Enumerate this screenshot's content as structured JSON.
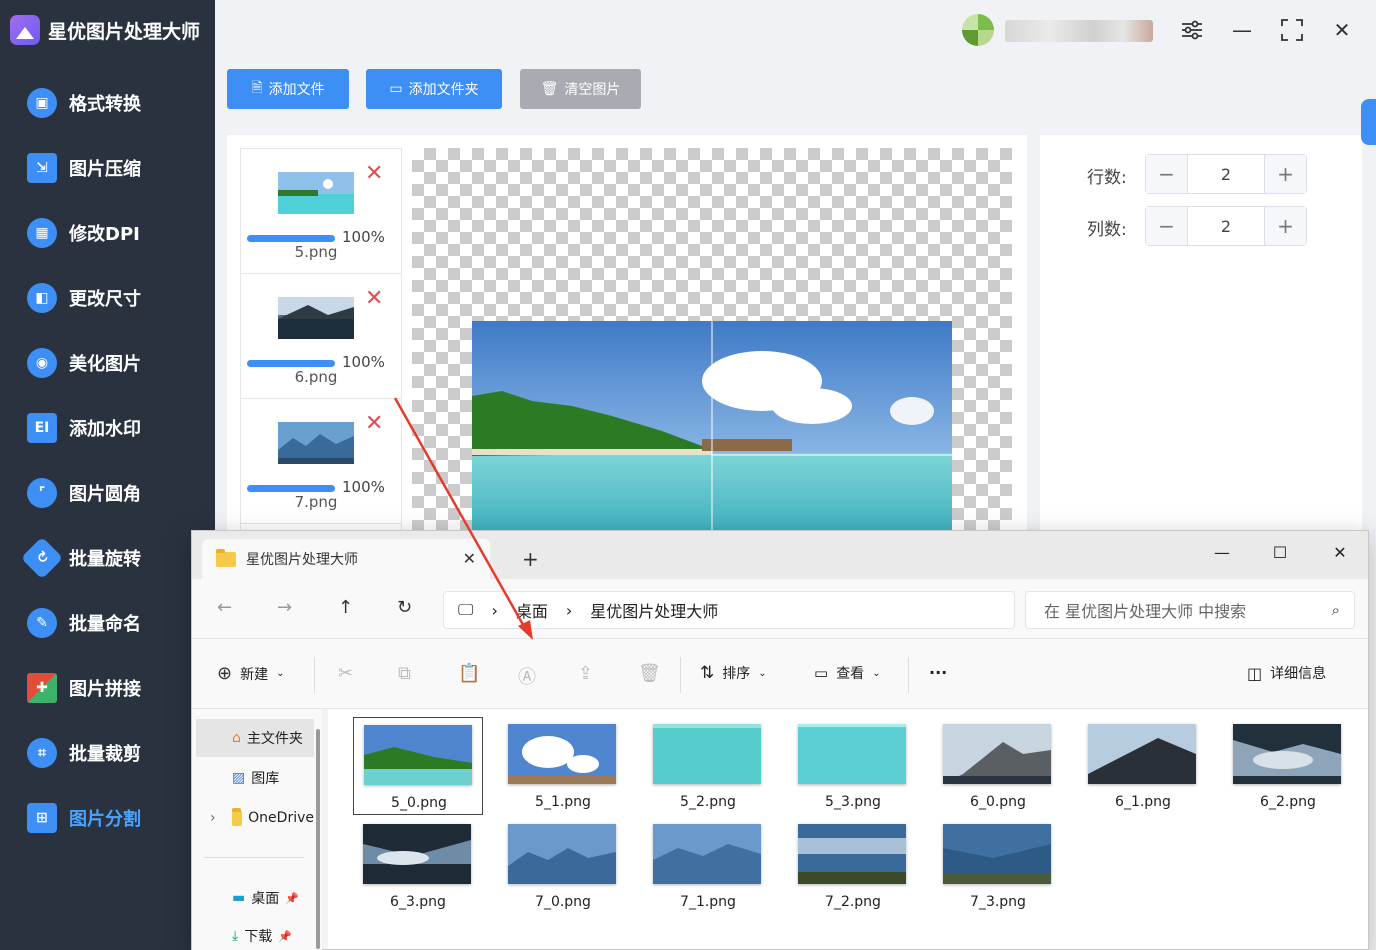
{
  "app": {
    "title": "星优图片处理大师"
  },
  "nav": [
    {
      "label": "格式转换",
      "icon": "image-convert-icon",
      "color": "#3d8ff5"
    },
    {
      "label": "图片压缩",
      "icon": "image-compress-icon",
      "color": "#3d8ff5"
    },
    {
      "label": "修改DPI",
      "icon": "dpi-icon",
      "color": "#3d8ff5"
    },
    {
      "label": "更改尺寸",
      "icon": "resize-icon",
      "color": "#3d8ff5"
    },
    {
      "label": "美化图片",
      "icon": "beautify-icon",
      "color": "#3d8ff5"
    },
    {
      "label": "添加水印",
      "icon": "watermark-icon",
      "color": "#3d8ff5"
    },
    {
      "label": "图片圆角",
      "icon": "round-corner-icon",
      "color": "#3d8ff5"
    },
    {
      "label": "批量旋转",
      "icon": "rotate-icon",
      "color": "#3d8ff5"
    },
    {
      "label": "批量命名",
      "icon": "rename-icon",
      "color": "#3d8ff5"
    },
    {
      "label": "图片拼接",
      "icon": "puzzle-icon",
      "color": "#e04e3a"
    },
    {
      "label": "批量裁剪",
      "icon": "crop-icon",
      "color": "#3d8ff5"
    },
    {
      "label": "图片分割",
      "icon": "split-icon",
      "color": "#3d8ff5",
      "active": true
    }
  ],
  "toolbar": {
    "add_file": "添加文件",
    "add_folder": "添加文件夹",
    "clear": "清空图片"
  },
  "files": [
    {
      "name": "5.png",
      "progress": "100%"
    },
    {
      "name": "6.png",
      "progress": "100%"
    },
    {
      "name": "7.png",
      "progress": "100%"
    }
  ],
  "settings": {
    "rows_label": "行数:",
    "rows_value": "2",
    "cols_label": "列数:",
    "cols_value": "2"
  },
  "explorer": {
    "tab_title": "星优图片处理大师",
    "breadcrumb": [
      "桌面",
      "星优图片处理大师"
    ],
    "search_placeholder": "在 星优图片处理大师 中搜索",
    "commands": {
      "new": "新建",
      "sort": "排序",
      "view": "查看",
      "more": "···",
      "details": "详细信息"
    },
    "nav_items": [
      "主文件夹",
      "图库",
      "OneDrive",
      "桌面",
      "下载"
    ],
    "files": [
      "5_0.png",
      "5_1.png",
      "5_2.png",
      "5_3.png",
      "6_0.png",
      "6_1.png",
      "6_2.png",
      "6_3.png",
      "7_0.png",
      "7_1.png",
      "7_2.png",
      "7_3.png"
    ]
  },
  "colors": {
    "accent": "#3d8ff5",
    "sidebar": "#2a3240",
    "delete": "#e05050",
    "arrow": "#e53b2c"
  }
}
